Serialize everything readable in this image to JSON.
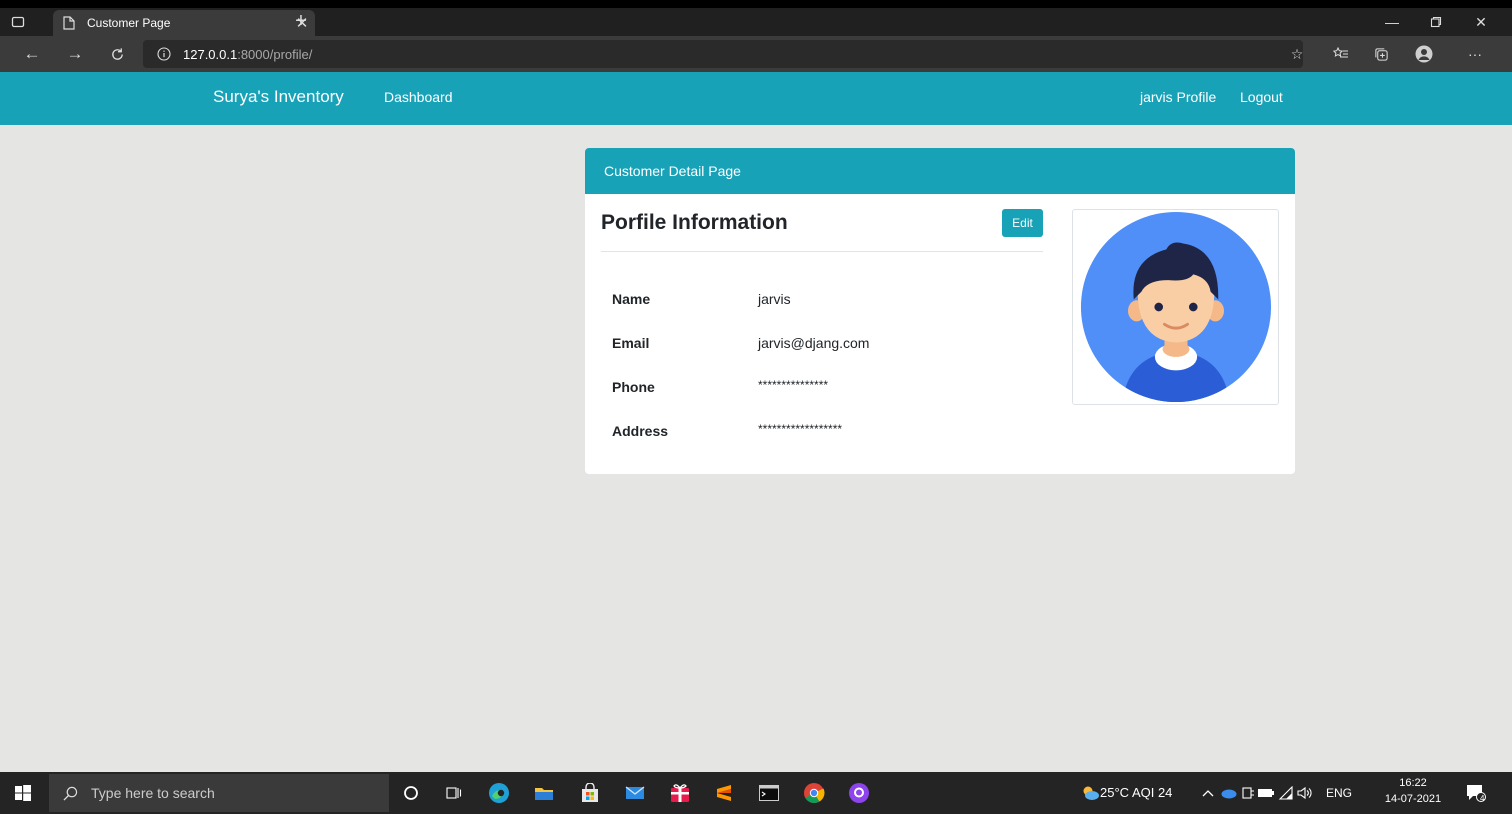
{
  "browser": {
    "tab_title": "Customer Page",
    "url_host": "127.0.0.1",
    "url_path": ":8000/profile/"
  },
  "navbar": {
    "brand": "Surya's Inventory",
    "dashboard": "Dashboard",
    "profile": "jarvis Profile",
    "logout": "Logout",
    "color": "#17a2b8"
  },
  "card": {
    "header": "Customer Detail Page",
    "heading": "Porfile Information",
    "edit_label": "Edit",
    "fields": [
      {
        "label": "Name",
        "value": "jarvis"
      },
      {
        "label": "Email",
        "value": "jarvis@djang.com"
      },
      {
        "label": "Phone",
        "value": "***************"
      },
      {
        "label": "Address",
        "value": "******************"
      }
    ]
  },
  "taskbar": {
    "search_placeholder": "Type here to search",
    "weather": "25°C  AQI 24",
    "language": "ENG",
    "time": "16:22",
    "date": "14-07-2021",
    "notifications": "4"
  }
}
